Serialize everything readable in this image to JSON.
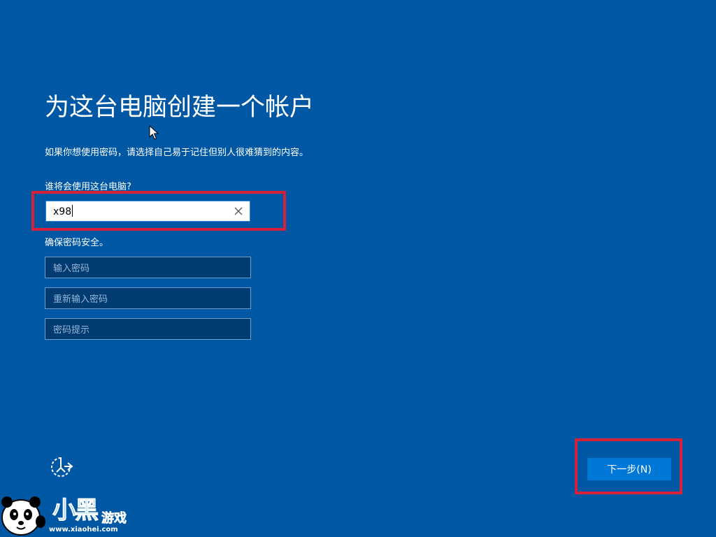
{
  "page": {
    "title": "为这台电脑创建一个帐户",
    "subtitle": "如果你想使用密码，请选择自己易于记住但别人很难猜到的内容。"
  },
  "username": {
    "label": "谁将会使用这台电脑?",
    "value": "x98",
    "clear_icon": "close-icon"
  },
  "password": {
    "section_label": "确保密码安全。",
    "password_placeholder": "输入密码",
    "confirm_placeholder": "重新输入密码",
    "hint_placeholder": "密码提示"
  },
  "footer": {
    "accessibility_icon": "ease-of-access-icon",
    "next_label": "下一步(N)"
  },
  "watermark": {
    "main": "小黑",
    "sub": "游戏",
    "url": "www.xiaohei.com"
  },
  "colors": {
    "background": "#0057a3",
    "button": "#0078d7",
    "highlight": "#d6213b"
  }
}
